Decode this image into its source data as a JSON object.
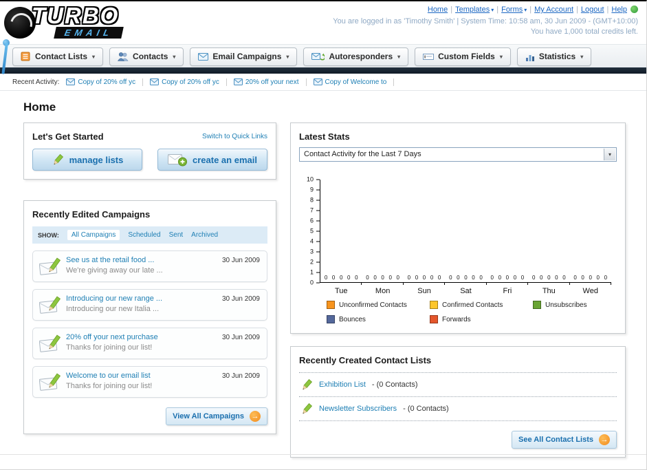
{
  "header": {
    "logo_line1": "TURBO",
    "logo_line2": "EMAIL",
    "nav_links": [
      {
        "label": "Home",
        "dropdown": false
      },
      {
        "label": "Templates",
        "dropdown": true
      },
      {
        "label": "Forms",
        "dropdown": true
      },
      {
        "label": "My Account",
        "dropdown": false
      },
      {
        "label": "Logout",
        "dropdown": false
      },
      {
        "label": "Help",
        "dropdown": false
      }
    ],
    "login_info": "You are logged in as 'Timothy Smith' | System Time: 10:58 am, 30 Jun 2009 - (GMT+10:00)",
    "credits": "You have 1,000 total credits left."
  },
  "nav_tabs": [
    {
      "label": "Contact Lists",
      "icon": "contact-lists-icon"
    },
    {
      "label": "Contacts",
      "icon": "contacts-icon"
    },
    {
      "label": "Email Campaigns",
      "icon": "email-campaigns-icon"
    },
    {
      "label": "Autoresponders",
      "icon": "autoresponders-icon"
    },
    {
      "label": "Custom Fields",
      "icon": "custom-fields-icon"
    },
    {
      "label": "Statistics",
      "icon": "statistics-icon"
    }
  ],
  "recent_activity": {
    "label": "Recent Activity:",
    "items": [
      "Copy of 20% off yc",
      "Copy of 20% off yc",
      "20% off your next",
      "Copy of Welcome to"
    ]
  },
  "page_title": "Home",
  "get_started": {
    "title": "Let's Get Started",
    "switch_link": "Switch to Quick Links",
    "buttons": [
      {
        "label": "manage lists",
        "icon": "pencil-icon"
      },
      {
        "label": "create an email",
        "icon": "envelope-plus-icon"
      }
    ]
  },
  "campaigns": {
    "title": "Recently Edited Campaigns",
    "show_label": "SHOW:",
    "filters": [
      "All Campaigns",
      "Scheduled",
      "Sent",
      "Archived"
    ],
    "active_filter": "All Campaigns",
    "items": [
      {
        "title": "See us at the retail food ...",
        "subtitle": "We're giving away our late ...",
        "date": "30 Jun 2009"
      },
      {
        "title": "Introducing our new range ...",
        "subtitle": "Introducing our new Italia ...",
        "date": "30 Jun 2009"
      },
      {
        "title": "20% off your next purchase",
        "subtitle": "Thanks for joining our list!",
        "date": "30 Jun 2009"
      },
      {
        "title": "Welcome to our email list",
        "subtitle": "Thanks for joining our list!",
        "date": "30 Jun 2009"
      }
    ],
    "view_all_label": "View All Campaigns"
  },
  "stats": {
    "title": "Latest Stats",
    "dropdown_value": "Contact Activity for the Last 7 Days"
  },
  "chart_data": {
    "type": "bar",
    "title": "Contact Activity for the Last 7 Days",
    "categories": [
      "Tue",
      "Mon",
      "Sun",
      "Sat",
      "Fri",
      "Thu",
      "Wed"
    ],
    "series": [
      {
        "name": "Unconfirmed Contacts",
        "color": "#f7941e",
        "values": [
          0,
          0,
          0,
          0,
          0,
          0,
          0
        ]
      },
      {
        "name": "Confirmed Contacts",
        "color": "#fdc62c",
        "values": [
          0,
          0,
          0,
          0,
          0,
          0,
          0
        ]
      },
      {
        "name": "Unsubscribes",
        "color": "#69a433",
        "values": [
          0,
          0,
          0,
          0,
          0,
          0,
          0
        ]
      },
      {
        "name": "Bounces",
        "color": "#54689b",
        "values": [
          0,
          0,
          0,
          0,
          0,
          0,
          0
        ]
      },
      {
        "name": "Forwards",
        "color": "#e4562b",
        "values": [
          0,
          0,
          0,
          0,
          0,
          0,
          0
        ]
      }
    ],
    "ylim": [
      0,
      10
    ],
    "ytick_step": 1,
    "show_value_labels": true,
    "grid": false,
    "legend_position": "bottom"
  },
  "contact_lists": {
    "title": "Recently Created Contact Lists",
    "items": [
      {
        "name": "Exhibition List",
        "detail": "- (0 Contacts)"
      },
      {
        "name": "Newsletter Subscribers",
        "detail": "- (0 Contacts)"
      }
    ],
    "see_all_label": "See All Contact Lists"
  },
  "icons": {
    "caret_down": "▾",
    "arrow_right": "→",
    "separator": "|"
  }
}
